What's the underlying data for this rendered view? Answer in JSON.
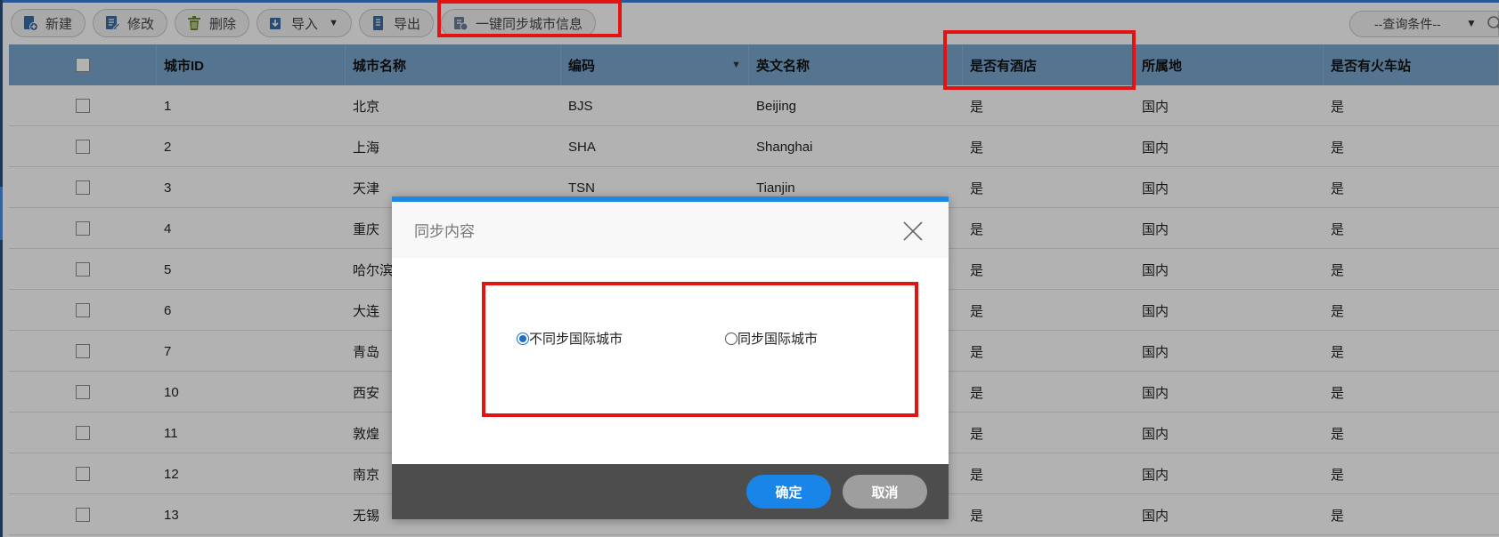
{
  "toolbar": {
    "new_label": "新建",
    "edit_label": "修改",
    "delete_label": "删除",
    "import_label": "导入",
    "export_label": "导出",
    "sync_label": "一键同步城市信息",
    "query_placeholder": "--查询条件--"
  },
  "table": {
    "columns": [
      "城市ID",
      "城市名称",
      "编码",
      "英文名称",
      "是否有酒店",
      "所属地",
      "是否有火车站"
    ],
    "rows": [
      {
        "id": "1",
        "name": "北京",
        "code": "BJS",
        "en": "Beijing",
        "hotel": "是",
        "region": "国内",
        "station": "是"
      },
      {
        "id": "2",
        "name": "上海",
        "code": "SHA",
        "en": "Shanghai",
        "hotel": "是",
        "region": "国内",
        "station": "是"
      },
      {
        "id": "3",
        "name": "天津",
        "code": "TSN",
        "en": "Tianjin",
        "hotel": "是",
        "region": "国内",
        "station": "是"
      },
      {
        "id": "4",
        "name": "重庆",
        "code": "",
        "en": "",
        "hotel": "是",
        "region": "国内",
        "station": "是"
      },
      {
        "id": "5",
        "name": "哈尔滨",
        "code": "",
        "en": "",
        "hotel": "是",
        "region": "国内",
        "station": "是"
      },
      {
        "id": "6",
        "name": "大连",
        "code": "",
        "en": "",
        "hotel": "是",
        "region": "国内",
        "station": "是"
      },
      {
        "id": "7",
        "name": "青岛",
        "code": "",
        "en": "",
        "hotel": "是",
        "region": "国内",
        "station": "是"
      },
      {
        "id": "10",
        "name": "西安",
        "code": "",
        "en": "",
        "hotel": "是",
        "region": "国内",
        "station": "是"
      },
      {
        "id": "11",
        "name": "敦煌",
        "code": "",
        "en": "",
        "hotel": "是",
        "region": "国内",
        "station": "是"
      },
      {
        "id": "12",
        "name": "南京",
        "code": "",
        "en": "",
        "hotel": "是",
        "region": "国内",
        "station": "是"
      },
      {
        "id": "13",
        "name": "无锡",
        "code": "",
        "en": "",
        "hotel": "是",
        "region": "国内",
        "station": "是"
      }
    ]
  },
  "dialog": {
    "title": "同步内容",
    "option_no_sync": "不同步国际城市",
    "option_sync": "同步国际城市",
    "selected": "不同步国际城市",
    "ok_label": "确定",
    "cancel_label": "取消"
  },
  "colors": {
    "header_bg": "#7aa7cf",
    "dialog_accent": "#1e88e5",
    "ok_button": "#1a85e8",
    "cancel_button": "#9e9e9e",
    "footer_bg": "#4d4d4d",
    "highlight": "#e21313"
  }
}
